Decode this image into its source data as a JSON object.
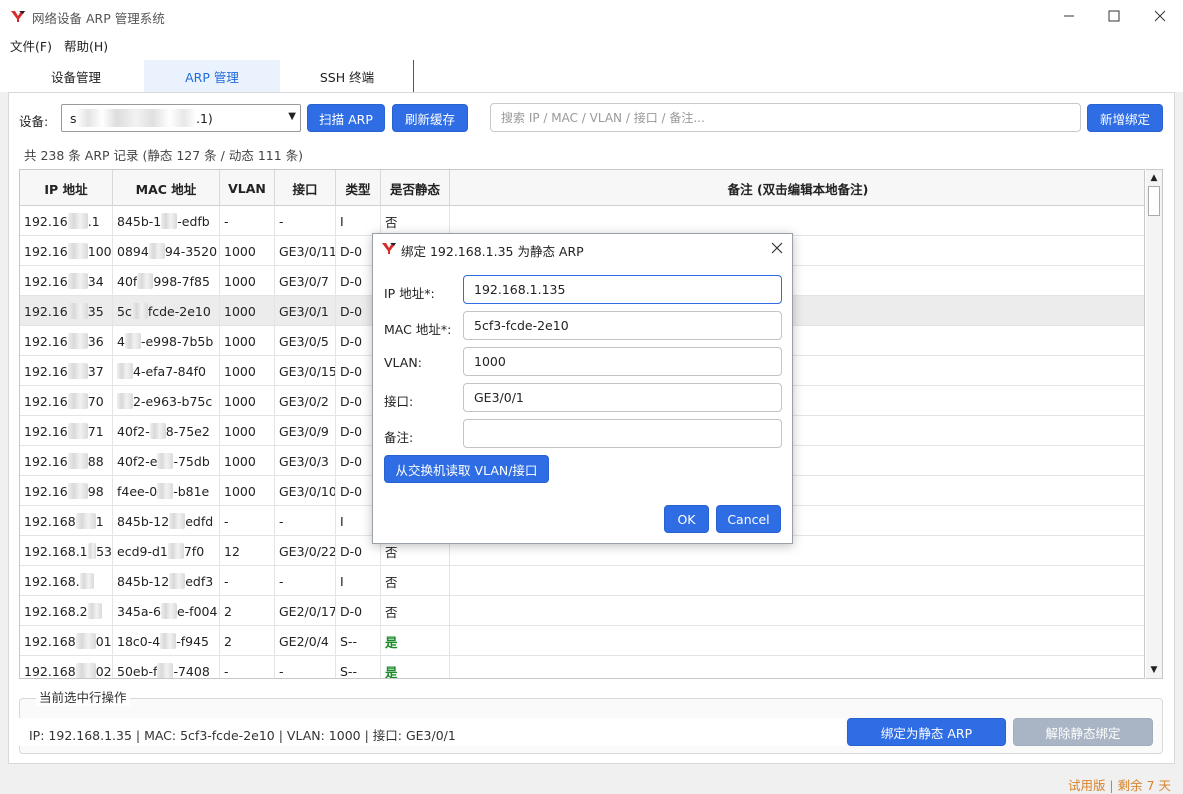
{
  "window": {
    "title": "网络设备 ARP 管理系统",
    "minimize_icon": "minimize-icon",
    "maximize_icon": "maximize-icon",
    "close_icon": "close-icon"
  },
  "menu": [
    {
      "label": "文件(F)"
    },
    {
      "label": "帮助(H)"
    }
  ],
  "tabs": [
    {
      "label": "设备管理",
      "active": false
    },
    {
      "label": "ARP 管理",
      "active": true
    },
    {
      "label": "SSH 终端",
      "active": false
    }
  ],
  "toolbar": {
    "device_label": "设备:",
    "device_value_prefix": "s",
    "device_value_suffix": ".1)",
    "scan_label": "扫描 ARP",
    "refresh_label": "刷新缓存",
    "search_placeholder": "搜索 IP / MAC / VLAN / 接口 / 备注...",
    "add_label": "新增绑定"
  },
  "summary": "共 238 条 ARP 记录 (静态 127 条 / 动态 111 条)",
  "table": {
    "columns": [
      "IP 地址",
      "MAC 地址",
      "VLAN",
      "接口",
      "类型",
      "是否静态",
      "备注 (双击编辑本地备注)"
    ],
    "rows": [
      {
        "ip_a": "192.16",
        "ip_b": ".1",
        "mac_a": "845b-1",
        "mac_b": "-edfb",
        "vlan": "-",
        "iface": "-",
        "type": "I",
        "static": "否"
      },
      {
        "ip_a": "192.16",
        "ip_b": "100",
        "mac_a": "0894",
        "mac_b": "94-3520",
        "vlan": "1000",
        "iface": "GE3/0/11",
        "type": "D-0",
        "static": ""
      },
      {
        "ip_a": "192.16",
        "ip_b": "34",
        "mac_a": "40f",
        "mac_b": "998-7f85",
        "vlan": "1000",
        "iface": "GE3/0/7",
        "type": "D-0",
        "static": ""
      },
      {
        "ip_a": "192.16",
        "ip_b": "35",
        "mac_a": "5c",
        "mac_b": "fcde-2e10",
        "vlan": "1000",
        "iface": "GE3/0/1",
        "type": "D-0",
        "static": "",
        "selected": true
      },
      {
        "ip_a": "192.16",
        "ip_b": "36",
        "mac_a": "4",
        "mac_b": "-e998-7b5b",
        "vlan": "1000",
        "iface": "GE3/0/5",
        "type": "D-0",
        "static": ""
      },
      {
        "ip_a": "192.16",
        "ip_b": "37",
        "mac_a": "",
        "mac_b": "4-efa7-84f0",
        "vlan": "1000",
        "iface": "GE3/0/15",
        "type": "D-0",
        "static": ""
      },
      {
        "ip_a": "192.16",
        "ip_b": "70",
        "mac_a": "",
        "mac_b": "2-e963-b75c",
        "vlan": "1000",
        "iface": "GE3/0/2",
        "type": "D-0",
        "static": ""
      },
      {
        "ip_a": "192.16",
        "ip_b": "71",
        "mac_a": "40f2-",
        "mac_b": "8-75e2",
        "vlan": "1000",
        "iface": "GE3/0/9",
        "type": "D-0",
        "static": ""
      },
      {
        "ip_a": "192.16",
        "ip_b": "88",
        "mac_a": "40f2-e",
        "mac_b": "-75db",
        "vlan": "1000",
        "iface": "GE3/0/3",
        "type": "D-0",
        "static": ""
      },
      {
        "ip_a": "192.16",
        "ip_b": "98",
        "mac_a": "f4ee-0",
        "mac_b": "-b81e",
        "vlan": "1000",
        "iface": "GE3/0/10",
        "type": "D-0",
        "static": ""
      },
      {
        "ip_a": "192.168",
        "ip_b": "1",
        "mac_a": "845b-12",
        "mac_b": "edfd",
        "vlan": "-",
        "iface": "-",
        "type": "I",
        "static": ""
      },
      {
        "ip_a": "192.168.1",
        "ip_b": "53",
        "mac_a": "ecd9-d1",
        "mac_b": "7f0",
        "vlan": "12",
        "iface": "GE3/0/22",
        "type": "D-0",
        "static": "否"
      },
      {
        "ip_a": "192.168.",
        "ip_b": "",
        "mac_a": "845b-12",
        "mac_b": "edf3",
        "vlan": "-",
        "iface": "-",
        "type": "I",
        "static": "否"
      },
      {
        "ip_a": "192.168.2",
        "ip_b": "",
        "mac_a": "345a-6",
        "mac_b": "e-f004",
        "vlan": "2",
        "iface": "GE2/0/17",
        "type": "D-0",
        "static": "否"
      },
      {
        "ip_a": "192.168",
        "ip_b": "01",
        "mac_a": "18c0-4",
        "mac_b": "-f945",
        "vlan": "2",
        "iface": "GE2/0/4",
        "type": "S--",
        "static": "是"
      },
      {
        "ip_a": "192.168",
        "ip_b": "02",
        "mac_a": "50eb-f",
        "mac_b": "-7408",
        "vlan": "-",
        "iface": "-",
        "type": "S--",
        "static": "是"
      }
    ]
  },
  "bottom": {
    "group_title": "当前选中行操作",
    "selection_info": "IP: 192.168.1.35 | MAC: 5cf3-fcde-2e10 | VLAN: 1000 | 接口: GE3/0/1",
    "bind_label": "绑定为静态 ARP",
    "unbind_label": "解除静态绑定"
  },
  "status_text": "试用版 | 剩余 7 天",
  "dialog": {
    "title": "绑定 192.168.1.35 为静态 ARP",
    "ip_label": "IP 地址*:",
    "ip_value": "192.168.1.135",
    "mac_label": "MAC 地址*:",
    "mac_value": "5cf3-fcde-2e10",
    "vlan_label": "VLAN:",
    "vlan_value": "1000",
    "iface_label": "接口:",
    "iface_value": "GE3/0/1",
    "note_label": "备注:",
    "note_value": "",
    "read_label": "从交换机读取 VLAN/接口",
    "ok_label": "OK",
    "cancel_label": "Cancel"
  },
  "colors": {
    "accent": "#2f6de5",
    "static_yes": "#1a8a2a",
    "trial": "#d9822b",
    "disabled": "#a9b5c4"
  }
}
